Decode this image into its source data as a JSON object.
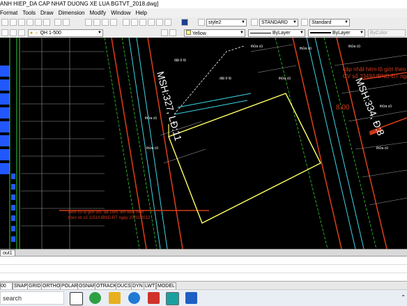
{
  "window": {
    "title": "ANH HIEP_DA CAP NHAT DUONG XE LUA BGTVT_2018.dwg]"
  },
  "menu": {
    "items": [
      "Format",
      "Tools",
      "Draw",
      "Dimension",
      "Modify",
      "Window",
      "Help"
    ]
  },
  "styles": {
    "text_style": "style2",
    "dim_style": "STANDARD",
    "table_style": "Standard"
  },
  "layers": {
    "current": "QH 1-500",
    "color": "Yellow",
    "linetype": "ByLayer",
    "lineweight": "ByLayer",
    "plotstyle": "ByColor"
  },
  "drawing": {
    "label_msh_left": "MSH:327, LĐ:11",
    "label_msh_right": "MSH:334, Đ:8",
    "red_note_top_right_1": "cập nhật hẻm lộ giới theo",
    "red_note_top_right_2": "CV số 3349/UBND-ĐT ngày",
    "red_note_bottom_1": "hẻm có lộ giới 5m, đã 28m, tim hẻm hiện",
    "red_note_bottom_2": "theo vb số 1151/UBND-ĐT ngày 20/02/2013",
    "dim_800": "8.00",
    "thua_labels": [
      "thửa cũ",
      "thửa cũ",
      "thửa cũ",
      "thửa cũ",
      "thửa cũ",
      "thửa cũ",
      "thửa cũ",
      "thửa cũ"
    ],
    "note_small_1": "đất ở lộ",
    "note_small_2": "đất ở lộ"
  },
  "layout_tab": "out1",
  "status": {
    "coord": "00",
    "toggles": [
      "SNAP",
      "GRID",
      "ORTHO",
      "POLAR",
      "OSNAP",
      "OTRACK",
      "DUCS",
      "DYN",
      "LWT",
      "MODEL"
    ]
  },
  "taskbar": {
    "search_placeholder": "search"
  },
  "colors": {
    "background": "#000000",
    "parcel_outline": "#ffff66",
    "road_red": "#d23b1a",
    "cyan": "#3ed6e6",
    "green": "#33cc33",
    "blue_blocks": "#2257ff"
  }
}
